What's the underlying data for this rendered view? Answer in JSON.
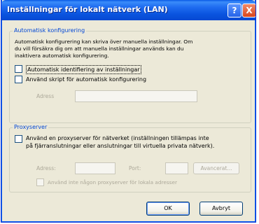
{
  "title": "Inställningar för lokalt nätverk (LAN)",
  "title_buttons": {
    "help": "?",
    "close": "X"
  },
  "auto_config": {
    "group_label": "Automatisk konfigurering",
    "description": [
      "Automatisk konfigurering kan skriva över manuella inställningar. Om",
      "du vill försäkra dig om att manuella inställningar används kan du",
      "inaktivera automatisk konfigurering."
    ],
    "auto_detect_label": "Automatisk identifiering av inställningar",
    "use_script_label": "Använd skript för automatisk konfigurering",
    "address_label": "Adress",
    "address_value": ""
  },
  "proxy": {
    "group_label": "Proxyserver",
    "use_proxy_label_line1": "Använd en proxyserver för nätverket (inställningen tillämpas inte",
    "use_proxy_label_line2": "på fjärranslutningar eller anslutningar till virtuella privata nätverk).",
    "address_label": "Adress:",
    "address_value": "",
    "port_label": "Port:",
    "port_value": "",
    "advanced_label": "Avancerat...",
    "bypass_label": "Använd inte någon proxyserver för lokala adresser"
  },
  "buttons": {
    "ok": "OK",
    "cancel": "Avbryt"
  },
  "colors": {
    "title_bar": "#0a54df",
    "group_label": "#0046d5",
    "dialog_bg": "#ece9d8"
  }
}
